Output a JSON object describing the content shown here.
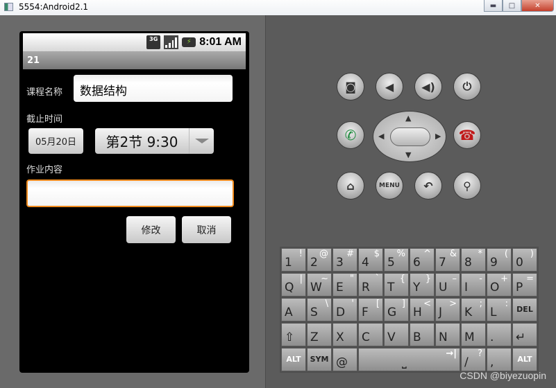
{
  "window": {
    "title": "5554:Android2.1",
    "minimize": "▬",
    "maximize": "□",
    "close": "✕"
  },
  "status": {
    "network": "3G",
    "time": "8:01 AM",
    "battery": "⚡"
  },
  "app": {
    "title": "21",
    "course_label": "课程名称",
    "course_value": "数据结构",
    "deadline_label": "截止时间",
    "date_button": "05月20日",
    "slot_value": "第2节 9:30",
    "content_label": "作业内容",
    "content_value": "",
    "modify_button": "修改",
    "cancel_button": "取消"
  },
  "controls": {
    "menu": "MENU"
  },
  "keyboard": {
    "rows": [
      [
        [
          "1",
          "!"
        ],
        [
          "2",
          "@"
        ],
        [
          "3",
          "#"
        ],
        [
          "4",
          "$"
        ],
        [
          "5",
          "%"
        ],
        [
          "6",
          "^"
        ],
        [
          "7",
          "&"
        ],
        [
          "8",
          "*"
        ],
        [
          "9",
          "("
        ],
        [
          "0",
          ")"
        ]
      ],
      [
        [
          "Q",
          "|"
        ],
        [
          "W",
          "~"
        ],
        [
          "E",
          "\""
        ],
        [
          "R",
          "`"
        ],
        [
          "T",
          "{"
        ],
        [
          "Y",
          "}"
        ],
        [
          "U",
          "–"
        ],
        [
          "I",
          "-"
        ],
        [
          "O",
          "+"
        ],
        [
          "P",
          "="
        ]
      ],
      [
        [
          "A",
          ""
        ],
        [
          "S",
          "\\"
        ],
        [
          "D",
          "'"
        ],
        [
          "F",
          "["
        ],
        [
          "G",
          "]"
        ],
        [
          "H",
          "<"
        ],
        [
          "J",
          ">"
        ],
        [
          "K",
          ";"
        ],
        [
          "L",
          ":"
        ],
        [
          "DEL",
          ""
        ]
      ],
      [
        [
          "⇧",
          ""
        ],
        [
          "Z",
          ""
        ],
        [
          "X",
          ""
        ],
        [
          "C",
          ""
        ],
        [
          "V",
          ""
        ],
        [
          "B",
          ""
        ],
        [
          "N",
          ""
        ],
        [
          "M",
          ""
        ],
        [
          ".",
          ""
        ],
        [
          "↵",
          ""
        ]
      ]
    ],
    "bottom": {
      "alt": "ALT",
      "sym": "SYM",
      "at": "@",
      "space": "⎵",
      "tab": "→|",
      "slash": "/",
      "question": "?",
      "comma": ","
    }
  },
  "watermark": "CSDN @biyezuopin"
}
